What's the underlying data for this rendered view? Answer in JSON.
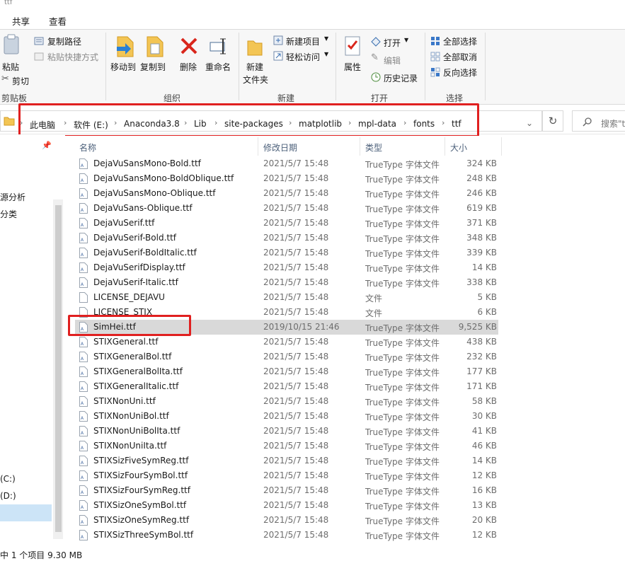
{
  "window": {
    "title": "ttf"
  },
  "tabs": [
    {
      "label": "共享"
    },
    {
      "label": "查看"
    }
  ],
  "ribbon": {
    "clipboard": {
      "paste": "粘贴",
      "copy_path": "复制路径",
      "paste_shortcut": "粘贴快捷方式",
      "cut": "剪切",
      "group": "剪贴板"
    },
    "organize": {
      "move_to": "移动到",
      "copy_to": "复制到",
      "delete": "删除",
      "rename": "重命名",
      "group": "组织"
    },
    "new": {
      "new_folder_line1": "新建",
      "new_folder_line2": "文件夹",
      "new_item": "新建项目",
      "easy_access": "轻松访问",
      "group": "新建"
    },
    "open": {
      "properties": "属性",
      "open": "打开",
      "edit": "编辑",
      "history": "历史记录",
      "group": "打开"
    },
    "select": {
      "select_all": "全部选择",
      "select_none": "全部取消",
      "invert": "反向选择",
      "group": "选择"
    }
  },
  "address": {
    "crumbs": [
      "此电脑",
      "软件 (E:)",
      "Anaconda3.8",
      "Lib",
      "site-packages",
      "matplotlib",
      "mpl-data",
      "fonts",
      "ttf"
    ],
    "search_placeholder": "搜索\"t"
  },
  "nav": {
    "items": [
      {
        "label": "源分析"
      },
      {
        "label": "分类"
      },
      {
        "label": "(C:)"
      },
      {
        "label": "(D:)"
      }
    ]
  },
  "columns": {
    "name": "名称",
    "date": "修改日期",
    "type": "类型",
    "size": "大小"
  },
  "files": [
    {
      "name": "DejaVuSansMono-Bold.ttf",
      "date": "2021/5/7 15:48",
      "type": "TrueType 字体文件",
      "size": "324 KB",
      "icon": "font-file-icon"
    },
    {
      "name": "DejaVuSansMono-BoldOblique.ttf",
      "date": "2021/5/7 15:48",
      "type": "TrueType 字体文件",
      "size": "248 KB",
      "icon": "font-file-icon"
    },
    {
      "name": "DejaVuSansMono-Oblique.ttf",
      "date": "2021/5/7 15:48",
      "type": "TrueType 字体文件",
      "size": "246 KB",
      "icon": "font-file-icon"
    },
    {
      "name": "DejaVuSans-Oblique.ttf",
      "date": "2021/5/7 15:48",
      "type": "TrueType 字体文件",
      "size": "619 KB",
      "icon": "font-file-icon"
    },
    {
      "name": "DejaVuSerif.ttf",
      "date": "2021/5/7 15:48",
      "type": "TrueType 字体文件",
      "size": "371 KB",
      "icon": "font-file-icon"
    },
    {
      "name": "DejaVuSerif-Bold.ttf",
      "date": "2021/5/7 15:48",
      "type": "TrueType 字体文件",
      "size": "348 KB",
      "icon": "font-file-icon"
    },
    {
      "name": "DejaVuSerif-BoldItalic.ttf",
      "date": "2021/5/7 15:48",
      "type": "TrueType 字体文件",
      "size": "339 KB",
      "icon": "font-file-icon"
    },
    {
      "name": "DejaVuSerifDisplay.ttf",
      "date": "2021/5/7 15:48",
      "type": "TrueType 字体文件",
      "size": "14 KB",
      "icon": "font-file-icon"
    },
    {
      "name": "DejaVuSerif-Italic.ttf",
      "date": "2021/5/7 15:48",
      "type": "TrueType 字体文件",
      "size": "338 KB",
      "icon": "font-file-icon"
    },
    {
      "name": "LICENSE_DEJAVU",
      "date": "2021/5/7 15:48",
      "type": "文件",
      "size": "5 KB",
      "icon": "blank-file-icon"
    },
    {
      "name": "LICENSE_STIX",
      "date": "2021/5/7 15:48",
      "type": "文件",
      "size": "6 KB",
      "icon": "blank-file-icon"
    },
    {
      "name": "SimHei.ttf",
      "date": "2019/10/15 21:46",
      "type": "TrueType 字体文件",
      "size": "9,525 KB",
      "icon": "font-file-icon",
      "selected": true
    },
    {
      "name": "STIXGeneral.ttf",
      "date": "2021/5/7 15:48",
      "type": "TrueType 字体文件",
      "size": "438 KB",
      "icon": "font-file-icon"
    },
    {
      "name": "STIXGeneralBol.ttf",
      "date": "2021/5/7 15:48",
      "type": "TrueType 字体文件",
      "size": "232 KB",
      "icon": "font-file-icon"
    },
    {
      "name": "STIXGeneralBolIta.ttf",
      "date": "2021/5/7 15:48",
      "type": "TrueType 字体文件",
      "size": "177 KB",
      "icon": "font-file-icon"
    },
    {
      "name": "STIXGeneralItalic.ttf",
      "date": "2021/5/7 15:48",
      "type": "TrueType 字体文件",
      "size": "171 KB",
      "icon": "font-file-icon"
    },
    {
      "name": "STIXNonUni.ttf",
      "date": "2021/5/7 15:48",
      "type": "TrueType 字体文件",
      "size": "58 KB",
      "icon": "font-file-icon"
    },
    {
      "name": "STIXNonUniBol.ttf",
      "date": "2021/5/7 15:48",
      "type": "TrueType 字体文件",
      "size": "30 KB",
      "icon": "font-file-icon"
    },
    {
      "name": "STIXNonUniBolIta.ttf",
      "date": "2021/5/7 15:48",
      "type": "TrueType 字体文件",
      "size": "41 KB",
      "icon": "font-file-icon"
    },
    {
      "name": "STIXNonUniIta.ttf",
      "date": "2021/5/7 15:48",
      "type": "TrueType 字体文件",
      "size": "46 KB",
      "icon": "font-file-icon"
    },
    {
      "name": "STIXSizFiveSymReg.ttf",
      "date": "2021/5/7 15:48",
      "type": "TrueType 字体文件",
      "size": "14 KB",
      "icon": "font-file-icon"
    },
    {
      "name": "STIXSizFourSymBol.ttf",
      "date": "2021/5/7 15:48",
      "type": "TrueType 字体文件",
      "size": "12 KB",
      "icon": "font-file-icon"
    },
    {
      "name": "STIXSizFourSymReg.ttf",
      "date": "2021/5/7 15:48",
      "type": "TrueType 字体文件",
      "size": "16 KB",
      "icon": "font-file-icon"
    },
    {
      "name": "STIXSizOneSymBol.ttf",
      "date": "2021/5/7 15:48",
      "type": "TrueType 字体文件",
      "size": "13 KB",
      "icon": "font-file-icon"
    },
    {
      "name": "STIXSizOneSymReg.ttf",
      "date": "2021/5/7 15:48",
      "type": "TrueType 字体文件",
      "size": "20 KB",
      "icon": "font-file-icon"
    },
    {
      "name": "STIXSizThreeSymBol.ttf",
      "date": "2021/5/7 15:48",
      "type": "TrueType 字体文件",
      "size": "12 KB",
      "icon": "font-file-icon"
    }
  ],
  "status": {
    "selection": "中 1 个项目  9.30 MB"
  },
  "colors": {
    "highlight": "#e02020",
    "selected_row": "#d9d9d9",
    "ribbon_bg": "#f7f7f7"
  }
}
